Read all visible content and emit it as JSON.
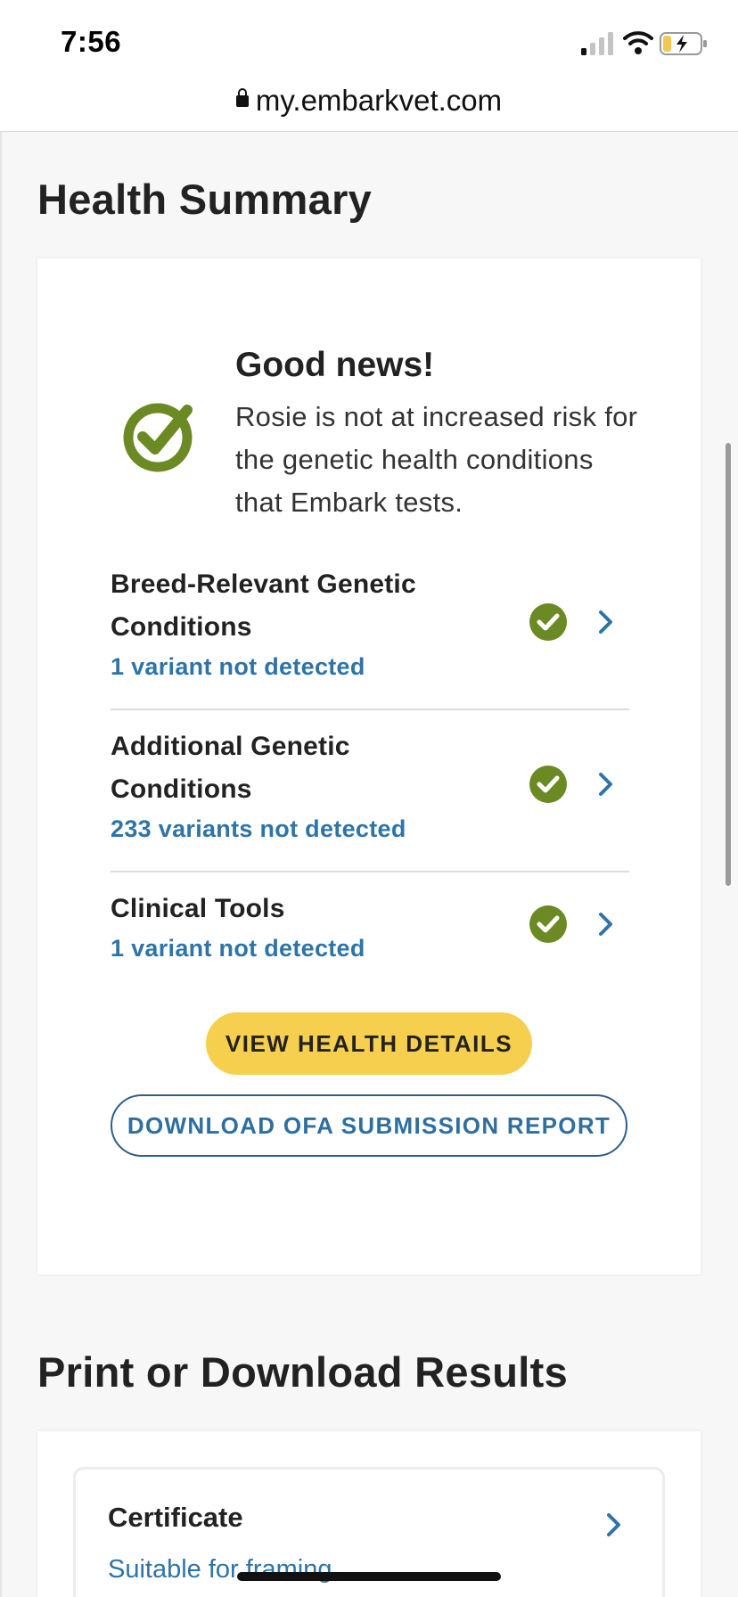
{
  "status_bar": {
    "time": "7:56"
  },
  "browser": {
    "url": "my.embarkvet.com"
  },
  "health_summary": {
    "title": "Health Summary",
    "good_news_title": "Good news!",
    "good_news_text": "Rosie is not at increased risk for the genetic health conditions that Embark tests.",
    "conditions": [
      {
        "title": "Breed-Relevant Genetic Conditions",
        "subtitle": "1 variant not detected"
      },
      {
        "title": "Additional Genetic Conditions",
        "subtitle": "233 variants not detected"
      },
      {
        "title": "Clinical Tools",
        "subtitle": "1 variant not detected"
      }
    ],
    "view_button": "VIEW HEALTH DETAILS",
    "download_button": "DOWNLOAD OFA SUBMISSION REPORT"
  },
  "print_download": {
    "title": "Print or Download Results",
    "items": [
      {
        "title": "Certificate",
        "subtitle": "Suitable for framing"
      }
    ]
  },
  "colors": {
    "check_green": "#6b8a23",
    "link_blue": "#2e74a8",
    "button_yellow": "#f6cf4e",
    "outline_blue": "#2e5f8a"
  }
}
